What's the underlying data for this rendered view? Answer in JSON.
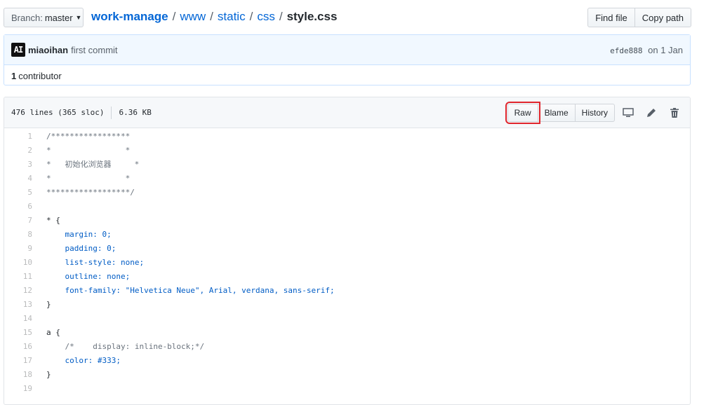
{
  "branch": {
    "prefix": "Branch:",
    "name": "master"
  },
  "breadcrumb": {
    "repo": "work-manage",
    "parts": [
      "www",
      "static",
      "css"
    ],
    "file": "style.css",
    "separator": "/"
  },
  "top_actions": {
    "find_file": "Find file",
    "copy_path": "Copy path"
  },
  "commit": {
    "avatar_text": "AI",
    "author": "miaoihan",
    "message": "first commit",
    "sha": "efde888",
    "date": "on 1 Jan"
  },
  "contributors": {
    "count": "1",
    "label": "contributor"
  },
  "file": {
    "lines": "476 lines (365 sloc)",
    "size": "6.36 KB",
    "actions": {
      "raw": "Raw",
      "blame": "Blame",
      "history": "History"
    },
    "icons": [
      "desktop-icon",
      "pencil-icon",
      "trash-icon"
    ]
  },
  "code_lines": [
    {
      "n": "1",
      "t": "/*****************"
    },
    {
      "n": "2",
      "t": "*                *"
    },
    {
      "n": "3",
      "t": "*   初始化浏览器     *"
    },
    {
      "n": "4",
      "t": "*                *"
    },
    {
      "n": "5",
      "t": "******************/"
    },
    {
      "n": "6",
      "t": ""
    },
    {
      "n": "7",
      "t": "* {"
    },
    {
      "n": "8",
      "t": "    margin: 0;"
    },
    {
      "n": "9",
      "t": "    padding: 0;"
    },
    {
      "n": "10",
      "t": "    list-style: none;"
    },
    {
      "n": "11",
      "t": "    outline: none;"
    },
    {
      "n": "12",
      "t": "    font-family: \"Helvetica Neue\", Arial, verdana, sans-serif;"
    },
    {
      "n": "13",
      "t": "}"
    },
    {
      "n": "14",
      "t": ""
    },
    {
      "n": "15",
      "t": "a {"
    },
    {
      "n": "16",
      "t": "    /*    display: inline-block;*/"
    },
    {
      "n": "17",
      "t": "    color: #333;"
    },
    {
      "n": "18",
      "t": "}"
    },
    {
      "n": "19",
      "t": ""
    }
  ],
  "colors": {
    "link": "#0366d6",
    "highlight": "#e0262d",
    "commit_bg": "#f1f8ff"
  }
}
